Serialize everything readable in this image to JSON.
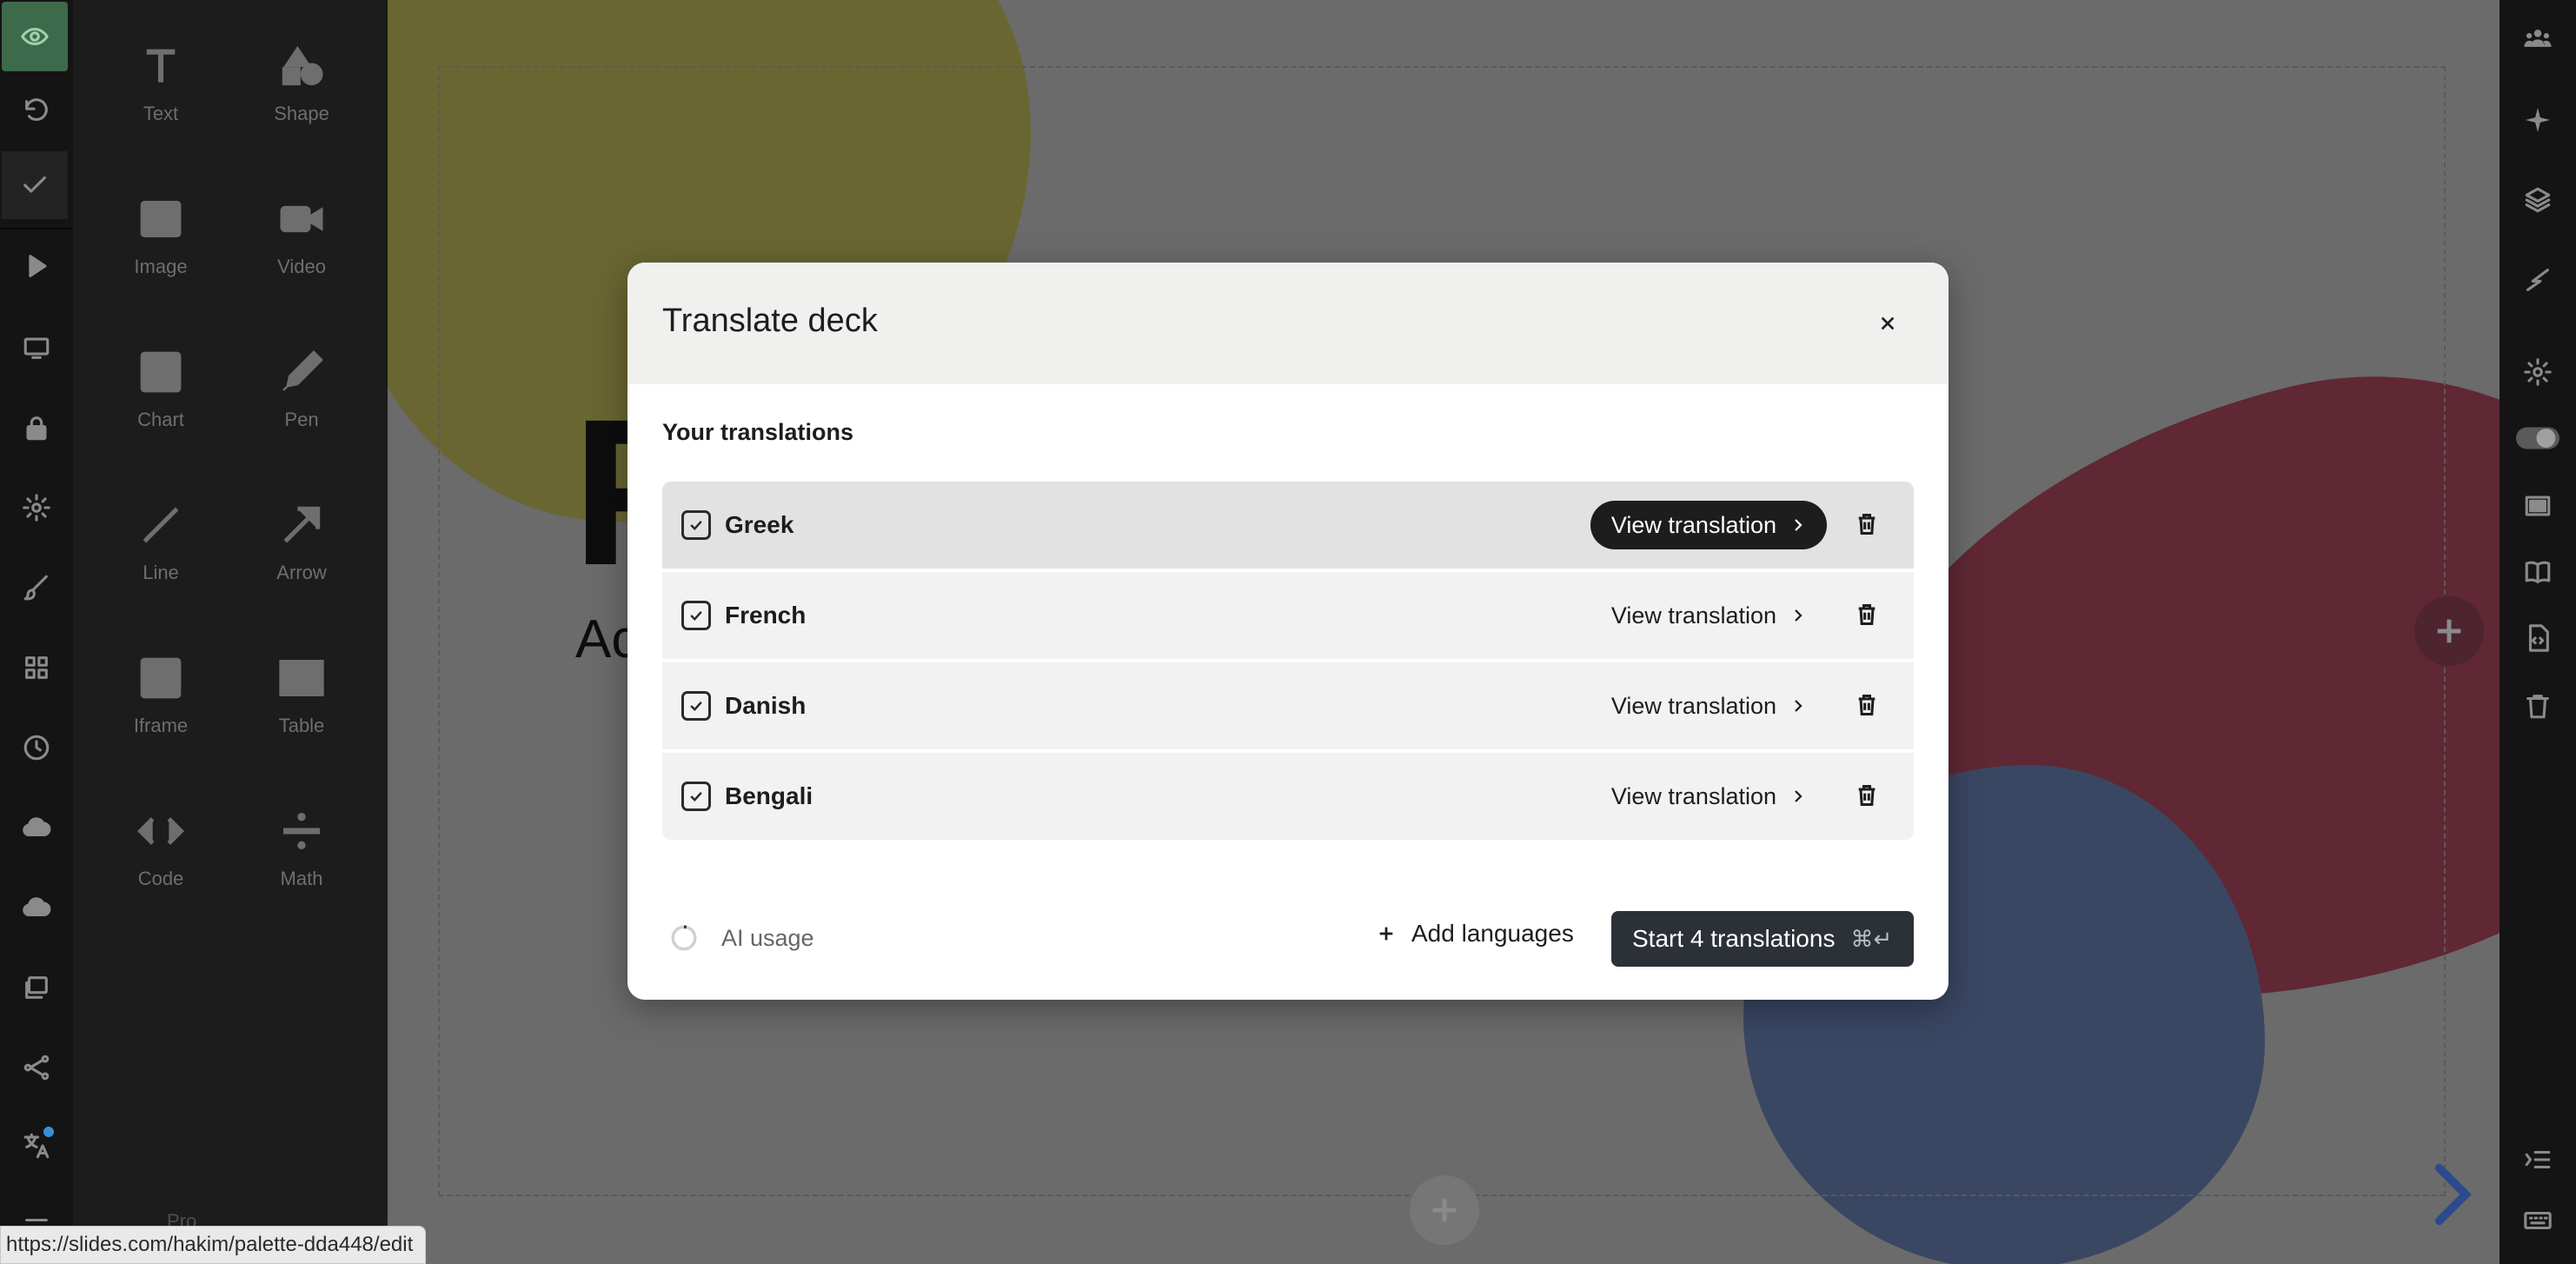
{
  "modal": {
    "title": "Translate deck",
    "section_label": "Your translations",
    "translations": [
      {
        "language": "Greek",
        "checked": true,
        "action": "View translation"
      },
      {
        "language": "French",
        "checked": true,
        "action": "View translation"
      },
      {
        "language": "Danish",
        "checked": true,
        "action": "View translation"
      },
      {
        "language": "Bengali",
        "checked": true,
        "action": "View translation"
      }
    ],
    "ai_usage_label": "AI usage",
    "add_languages_label": "Add languages",
    "start_button_label": "Start 4 translations",
    "start_button_shortcut": "⌘↵"
  },
  "tools": [
    {
      "label": "Text",
      "icon": "text-icon"
    },
    {
      "label": "Shape",
      "icon": "shape-icon"
    },
    {
      "label": "Image",
      "icon": "image-icon"
    },
    {
      "label": "Video",
      "icon": "video-icon"
    },
    {
      "label": "Chart",
      "icon": "chart-icon"
    },
    {
      "label": "Pen",
      "icon": "pen-icon"
    },
    {
      "label": "Line",
      "icon": "line-icon"
    },
    {
      "label": "Arrow",
      "icon": "arrow-icon"
    },
    {
      "label": "Iframe",
      "icon": "iframe-icon"
    },
    {
      "label": "Table",
      "icon": "table-icon"
    },
    {
      "label": "Code",
      "icon": "code-icon"
    },
    {
      "label": "Math",
      "icon": "math-icon"
    }
  ],
  "tools_footer": {
    "plan_label": "Pro"
  },
  "slide": {
    "title_letter": "F",
    "subtitle_letters": "Ac"
  },
  "status_url": "https://slides.com/hakim/palette-dda448/edit",
  "colors": {
    "modal_header_bg": "#f0f0ef",
    "primary_button": "#2b3136",
    "canvas_overlay": "#6b6b6b"
  }
}
